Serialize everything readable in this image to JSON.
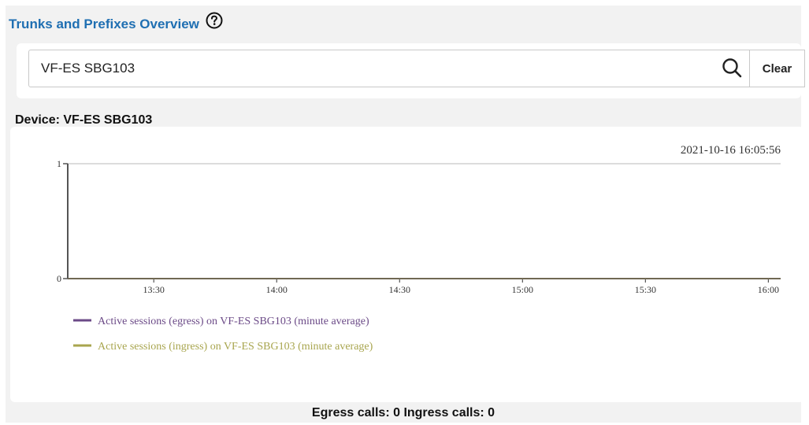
{
  "header": {
    "title": "Trunks and Prefixes Overview",
    "help_icon": "question-circle-icon"
  },
  "search": {
    "value": "VF-ES SBG103",
    "search_icon": "search-icon",
    "clear_label": "Clear"
  },
  "device": {
    "label": "Device: VF-ES SBG103"
  },
  "chart_data": {
    "type": "line",
    "timestamp": "2021-10-16 16:05:56",
    "x_tick_labels": [
      "13:30",
      "14:00",
      "14:30",
      "15:00",
      "15:30",
      "16:00"
    ],
    "x_tick_values": [
      "13:30",
      "14:00",
      "14:30",
      "15:00",
      "15:30",
      "16:00"
    ],
    "xlim": [
      "13:09",
      "16:03"
    ],
    "y_tick_labels": [
      "0",
      "1"
    ],
    "ylim": [
      0,
      1
    ],
    "grid": "horizontal at y=1",
    "legend_placement": "bottom-left",
    "series": [
      {
        "name": "Active sessions (egress) on VF-ES SBG103 (minute average)",
        "color": "#6b4a87",
        "values": [
          0,
          0,
          0,
          0,
          0,
          0
        ]
      },
      {
        "name": "Active sessions (ingress) on VF-ES SBG103 (minute average)",
        "color": "#a8a54e",
        "values": [
          0,
          0,
          0,
          0,
          0,
          0
        ]
      }
    ]
  },
  "footer": {
    "summary": "Egress calls: 0 Ingress calls: 0"
  }
}
